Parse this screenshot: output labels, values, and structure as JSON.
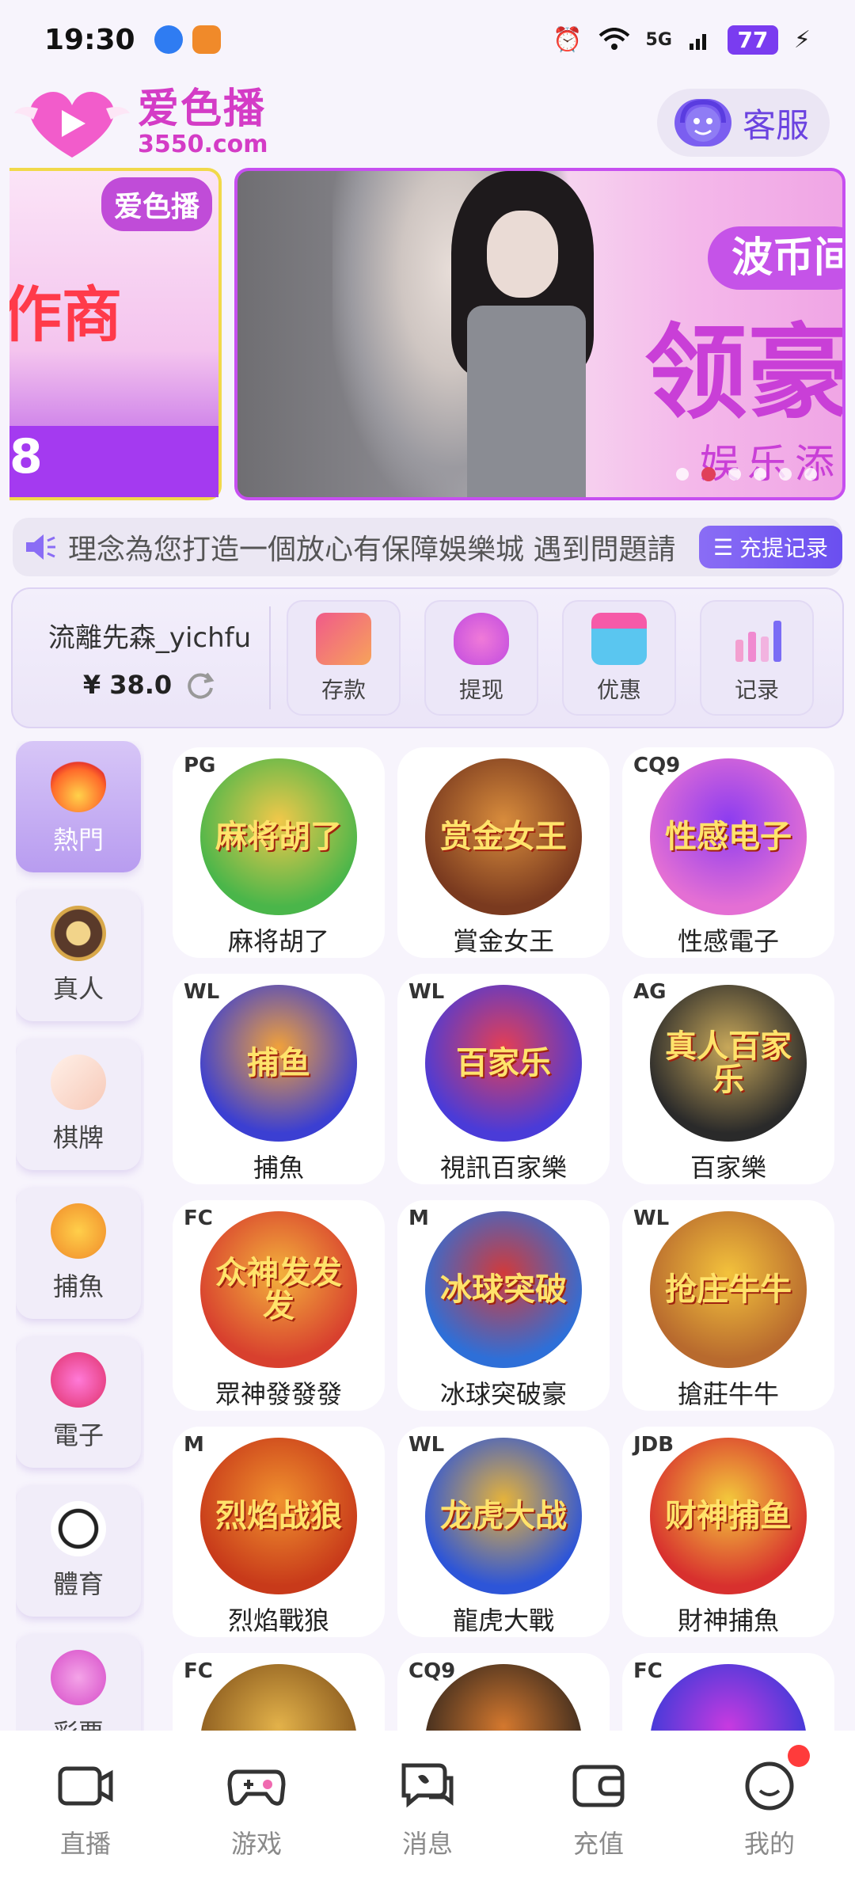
{
  "status_bar": {
    "time": "19:30",
    "network": "5G",
    "battery": "77"
  },
  "header": {
    "logo_name": "爱色播",
    "logo_domain": "3550.com",
    "customer_service_label": "客服"
  },
  "banner": {
    "left_logo": "爱色播",
    "left_text": "作商",
    "left_number": "8",
    "pill_text": "波币间",
    "big_text": "领豪",
    "small_text": "娱乐添",
    "dot_count": 6,
    "active_dot": 1
  },
  "notice": {
    "text": "理念為您打造一個放心有保障娛樂城  遇到問題請",
    "button_label": "充提记录"
  },
  "account": {
    "username": "流離先森_yichfu",
    "balance": "¥ 38.0",
    "actions": [
      {
        "label": "存款",
        "icon": "card-icon"
      },
      {
        "label": "提现",
        "icon": "money-bag-icon"
      },
      {
        "label": "优惠",
        "icon": "gift-icon"
      },
      {
        "label": "记录",
        "icon": "bar-chart-icon"
      }
    ]
  },
  "categories": [
    {
      "label": "熱門",
      "icon": "flame-icon",
      "active": true
    },
    {
      "label": "真人",
      "icon": "poker-chip-icon"
    },
    {
      "label": "棋牌",
      "icon": "playing-card-icon"
    },
    {
      "label": "捕魚",
      "icon": "fish-icon"
    },
    {
      "label": "電子",
      "icon": "slot-machine-icon"
    },
    {
      "label": "體育",
      "icon": "soccer-ball-icon"
    },
    {
      "label": "彩票",
      "icon": "lottery-ball-icon"
    }
  ],
  "games": [
    {
      "name": "麻将胡了",
      "brand": "PG",
      "art": "麻将胡了",
      "colors": [
        "#4ab64a",
        "#f2c84a"
      ]
    },
    {
      "name": "賞金女王",
      "brand": "",
      "art": "赏金女王",
      "colors": [
        "#7a3a1f",
        "#d88c3c"
      ]
    },
    {
      "name": "性感電子",
      "brand": "CQ9",
      "art": "性感电子",
      "colors": [
        "#e46fd4",
        "#8c3cf0"
      ]
    },
    {
      "name": "捕魚",
      "brand": "WL",
      "art": "捕鱼",
      "colors": [
        "#3b3fd2",
        "#f1a13a"
      ]
    },
    {
      "name": "視訊百家樂",
      "brand": "WL",
      "art": "百家乐",
      "colors": [
        "#4a3bd8",
        "#e43f54"
      ]
    },
    {
      "name": "百家樂",
      "brand": "AG",
      "art": "真人百家乐",
      "colors": [
        "#2a2a2a",
        "#c8a85a"
      ]
    },
    {
      "name": "眾神發發發",
      "brand": "FC",
      "art": "众神发发发",
      "colors": [
        "#d8402e",
        "#f3b13c"
      ]
    },
    {
      "name": "冰球突破豪",
      "brand": "M",
      "art": "冰球突破",
      "colors": [
        "#2e6fd8",
        "#d23a3a"
      ]
    },
    {
      "name": "搶莊牛牛",
      "brand": "WL",
      "art": "抢庄牛牛",
      "colors": [
        "#b86a2e",
        "#f3c23c"
      ]
    },
    {
      "name": "烈焰戰狼",
      "brand": "M",
      "art": "烈焰战狼",
      "colors": [
        "#c83a1a",
        "#f0922e"
      ]
    },
    {
      "name": "龍虎大戰",
      "brand": "WL",
      "art": "龙虎大战",
      "colors": [
        "#2d55d8",
        "#e6b33a"
      ]
    },
    {
      "name": "財神捕魚",
      "brand": "JDB",
      "art": "财神捕鱼",
      "colors": [
        "#d8302e",
        "#f3c93c"
      ]
    },
    {
      "name": "",
      "brand": "FC",
      "art": "",
      "colors": [
        "#8a5a1e",
        "#e3b24a"
      ]
    },
    {
      "name": "",
      "brand": "CQ9",
      "art": "",
      "colors": [
        "#3a2a1e",
        "#d4782e"
      ]
    },
    {
      "name": "",
      "brand": "FC",
      "art": "",
      "colors": [
        "#3a3ad8",
        "#c83ae0"
      ]
    }
  ],
  "bottom_nav": [
    {
      "label": "直播",
      "icon": "video-camera-icon"
    },
    {
      "label": "游戏",
      "icon": "gamepad-icon"
    },
    {
      "label": "消息",
      "icon": "chat-bubbles-icon"
    },
    {
      "label": "充值",
      "icon": "wallet-icon"
    },
    {
      "label": "我的",
      "icon": "smiley-icon",
      "badge": true
    }
  ]
}
